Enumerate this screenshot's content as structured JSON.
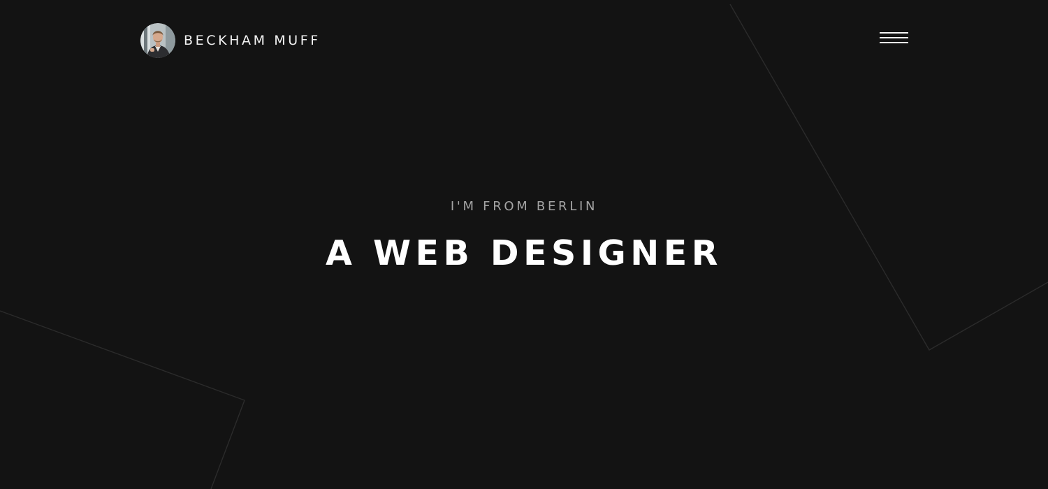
{
  "header": {
    "brand_name": "BECKHAM MUFF",
    "avatar_alt": "Beckham Muff portrait",
    "menu_icon": "hamburger-menu-icon"
  },
  "hero": {
    "subtitle": "I'M FROM BERLIN",
    "title": "A WEB DESIGNER"
  },
  "colors": {
    "background": "#131313",
    "text_primary": "#ffffff",
    "text_secondary": "#a4a4a4",
    "decor_line": "#2b2b2b"
  }
}
